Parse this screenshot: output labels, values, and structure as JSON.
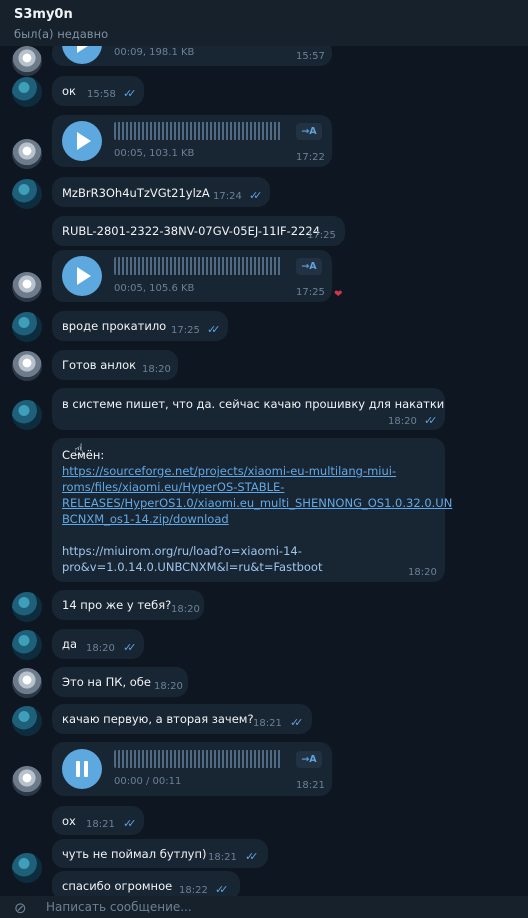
{
  "header": {
    "name": "S3my0n",
    "status": "был(а) недавно"
  },
  "messages": [
    {
      "meta": "00:09, 198.1 KB",
      "time": "15:57"
    },
    {
      "text": "ок",
      "time": "15:58"
    },
    {
      "meta": "00:05, 103.1 KB",
      "time": "17:22",
      "transcribe": "→A"
    },
    {
      "text": "MzBrR3Oh4uTzVGt21ylzA",
      "time": "17:24"
    },
    {
      "text": "RUBL-2801-2322-38NV-07GV-05EJ-11IF-2224",
      "time": "17:25"
    },
    {
      "meta": "00:05, 105.6 KB",
      "time": "17:25",
      "transcribe": "→A",
      "reaction": "❤"
    },
    {
      "text": "вроде прокатило",
      "time": "17:25"
    },
    {
      "text": "Готов анлок",
      "time": "18:20"
    },
    {
      "text": "в системе пишет, что да. сейчас качаю прошивку для накатки",
      "time": "18:20"
    },
    {
      "sender": "Семён:",
      "link1": [
        "https://sourceforge.net/projects/xiaomi-eu-multilang-miui-",
        "roms/files/xiaomi.eu/HyperOS-STABLE-",
        "RELEASES/HyperOS1.0/xiaomi.eu_multi_SHENNONG_OS1.0.32.0.UN",
        "BCNXM_os1-14.zip/download"
      ],
      "link2": [
        "https://miuirom.org/ru/load?o=xiaomi-14-",
        "pro&v=1.0.14.0.UNBCNXM&l=ru&t=Fastboot"
      ],
      "time": "18:20"
    },
    {
      "text": "14 про же у тебя?",
      "time": "18:20"
    },
    {
      "text": "да",
      "time": "18:20"
    },
    {
      "text": "Это на ПК, обе",
      "time": "18:20"
    },
    {
      "text": "качаю первую, а вторая зачем?",
      "time": "18:21"
    },
    {
      "meta": "00:00 / 00:11",
      "time": "18:21",
      "transcribe": "→A"
    },
    {
      "text": "ох",
      "time": "18:21"
    },
    {
      "text": "чуть не поймал бутлуп)",
      "time": "18:21"
    },
    {
      "text": "спасибо огромное",
      "time": "18:22"
    }
  ],
  "input": {
    "placeholder": "Написать сообщение..."
  },
  "colors": {
    "background": "#0e1621",
    "bubble": "#182533",
    "accent": "#5ea8e0",
    "link": "#61a9e6"
  },
  "icons": {
    "attach": "paperclip-icon",
    "read": "double-check-icon",
    "reaction": "heart-icon"
  }
}
